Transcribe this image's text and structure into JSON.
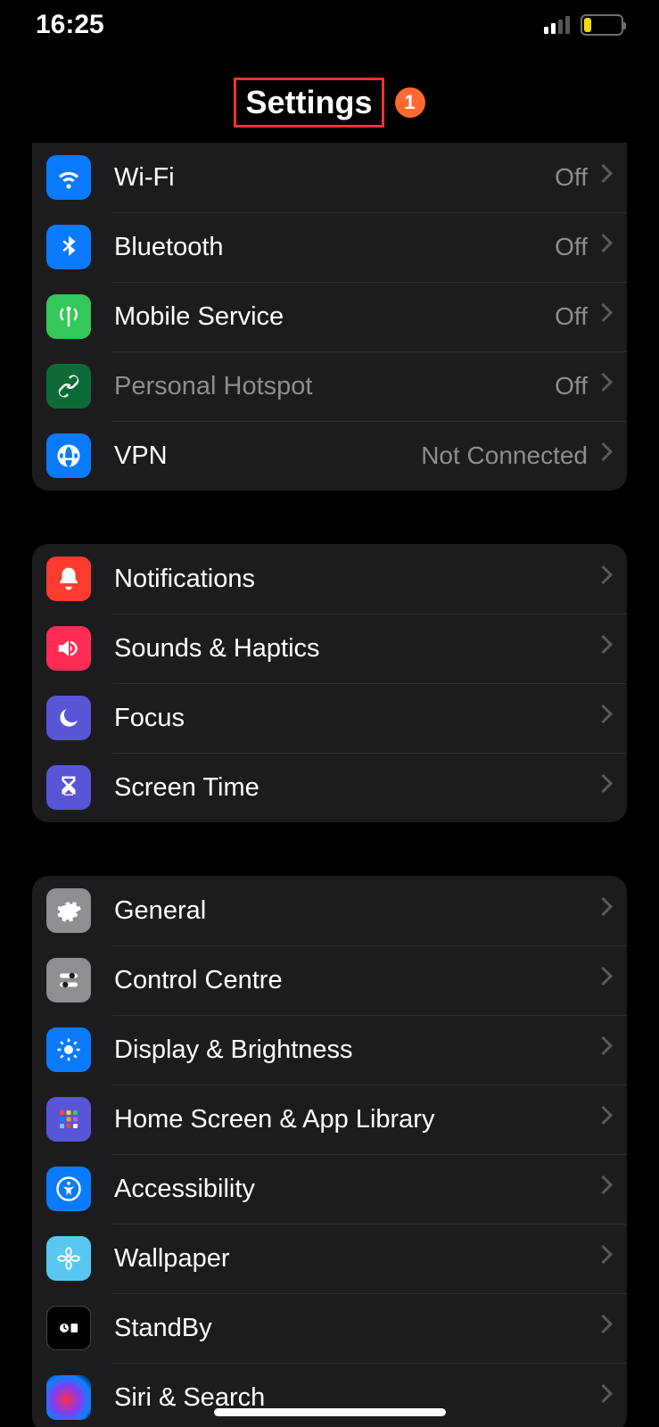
{
  "status": {
    "time": "16:25"
  },
  "header": {
    "title": "Settings",
    "badge": "1"
  },
  "groups": [
    {
      "rows": [
        {
          "icon": "wifi",
          "bg": "bg-blue",
          "label": "Wi-Fi",
          "value": "Off"
        },
        {
          "icon": "bluetooth",
          "bg": "bg-blue",
          "label": "Bluetooth",
          "value": "Off"
        },
        {
          "icon": "antenna",
          "bg": "bg-green",
          "label": "Mobile Service",
          "value": "Off"
        },
        {
          "icon": "link",
          "bg": "bg-darkgreen",
          "label": "Personal Hotspot",
          "value": "Off",
          "dim": true
        },
        {
          "icon": "globe",
          "bg": "bg-blue",
          "label": "VPN",
          "value": "Not Connected"
        }
      ]
    },
    {
      "rows": [
        {
          "icon": "bell",
          "bg": "bg-red",
          "label": "Notifications"
        },
        {
          "icon": "speaker",
          "bg": "bg-pink",
          "label": "Sounds & Haptics"
        },
        {
          "icon": "moon",
          "bg": "bg-indigo",
          "label": "Focus"
        },
        {
          "icon": "hourglass",
          "bg": "bg-indigo",
          "label": "Screen Time"
        }
      ]
    },
    {
      "rows": [
        {
          "icon": "gear",
          "bg": "bg-gray",
          "label": "General"
        },
        {
          "icon": "sliders",
          "bg": "bg-gray",
          "label": "Control Centre"
        },
        {
          "icon": "sun",
          "bg": "bg-blue",
          "label": "Display & Brightness"
        },
        {
          "icon": "grid",
          "bg": "bg-indigo",
          "label": "Home Screen & App Library"
        },
        {
          "icon": "accessibility",
          "bg": "bg-blue",
          "label": "Accessibility"
        },
        {
          "icon": "flower",
          "bg": "bg-cyan",
          "label": "Wallpaper"
        },
        {
          "icon": "standby",
          "bg": "bg-black",
          "label": "StandBy"
        },
        {
          "icon": "siri",
          "bg": "bg-siri",
          "label": "Siri & Search"
        }
      ]
    }
  ]
}
